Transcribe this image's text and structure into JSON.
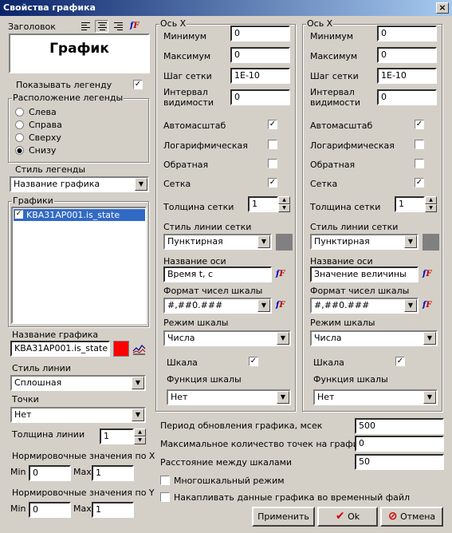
{
  "window": {
    "title": "Свойства графика",
    "close": "×"
  },
  "left": {
    "header_label": "Заголовок",
    "title_text": "График",
    "show_legend_label": "Показывать легенду",
    "show_legend_checked": true,
    "legend_position_label": "Расположение легенды",
    "legend_positions": [
      "Слева",
      "Справа",
      "Сверху",
      "Снизу"
    ],
    "legend_position_selected": "Снизу",
    "legend_style_label": "Стиль легенды",
    "legend_style_value": "Название графика",
    "graphs_label": "Графики",
    "graphs": [
      {
        "name": "KBA31AP001.is_state",
        "checked": true
      }
    ],
    "graph_name_label": "Название графика",
    "graph_name_value": "KBA31AP001.is_state",
    "graph_color": "#ff0000",
    "line_style_label": "Стиль линии",
    "line_style_value": "Сплошная",
    "points_label": "Точки",
    "points_value": "Нет",
    "line_width_label": "Толщина линии",
    "line_width_value": "1",
    "norm_x_label": "Нормировочные значения по X",
    "norm_y_label": "Нормировочные значения по Y",
    "min_label": "Min",
    "max_label": "Max",
    "norm_x_min": "0",
    "norm_x_max": "1",
    "norm_y_min": "0",
    "norm_y_max": "1"
  },
  "axes": [
    {
      "title": "Ось X",
      "min_label": "Минимум",
      "min_value": "0",
      "max_label": "Максимум",
      "max_value": "0",
      "grid_step_label": "Шаг сетки",
      "grid_step_value": "1E-10",
      "vis_interval_label": "Интервал видимости",
      "vis_interval_value": "0",
      "autoscale_label": "Автомасштаб",
      "autoscale": true,
      "log_label": "Логарифмическая",
      "log": false,
      "reverse_label": "Обратная",
      "reverse": false,
      "grid_label": "Сетка",
      "grid": true,
      "grid_width_label": "Толщина сетки",
      "grid_width_value": "1",
      "grid_style_label": "Стиль линии сетки",
      "grid_style_value": "Пунктирная",
      "grid_color": "#808080",
      "axis_name_label": "Название оси",
      "axis_name_value": "Время t, с",
      "number_format_label": "Формат чисел шкалы",
      "number_format_value": "#,##0.###",
      "scale_mode_label": "Режим шкалы",
      "scale_mode_value": "Числа",
      "scale_label": "Шкала",
      "scale": true,
      "scale_func_label": "Функция шкалы",
      "scale_func_value": "Нет"
    },
    {
      "title": "Ось X",
      "min_label": "Минимум",
      "min_value": "0",
      "max_label": "Максимум",
      "max_value": "0",
      "grid_step_label": "Шаг сетки",
      "grid_step_value": "1E-10",
      "vis_interval_label": "Интервал видимости",
      "vis_interval_value": "0",
      "autoscale_label": "Автомасштаб",
      "autoscale": true,
      "log_label": "Логарифмическая",
      "log": false,
      "reverse_label": "Обратная",
      "reverse": false,
      "grid_label": "Сетка",
      "grid": true,
      "grid_width_label": "Толщина сетки",
      "grid_width_value": "1",
      "grid_style_label": "Стиль линии сетки",
      "grid_style_value": "Пунктирная",
      "grid_color": "#808080",
      "axis_name_label": "Название оси",
      "axis_name_value": "Значение величины",
      "number_format_label": "Формат чисел шкалы",
      "number_format_value": "#,##0.###",
      "scale_mode_label": "Режим шкалы",
      "scale_mode_value": "Числа",
      "scale_label": "Шкала",
      "scale": true,
      "scale_func_label": "Функция шкалы",
      "scale_func_value": "Нет"
    }
  ],
  "bottom": {
    "update_period_label": "Период обновления графика, мсек",
    "update_period_value": "500",
    "max_points_label": "Максимальное количество точек на графике",
    "max_points_value": "0",
    "scale_distance_label": "Расстояние между шкалами",
    "scale_distance_value": "50",
    "multiscale_label": "Многошкальный режим",
    "multiscale": false,
    "accumulate_label": "Накапливать данные графика во временный файл",
    "accumulate": false
  },
  "buttons": {
    "apply": "Применить",
    "ok": "Ok",
    "cancel": "Отмена"
  },
  "icons": {
    "check": "✓",
    "radio_dot": "●",
    "arrow_down": "▼",
    "arrow_up": "▲",
    "ok": "✔",
    "cancel": "⊘",
    "font_icon": "fF"
  }
}
